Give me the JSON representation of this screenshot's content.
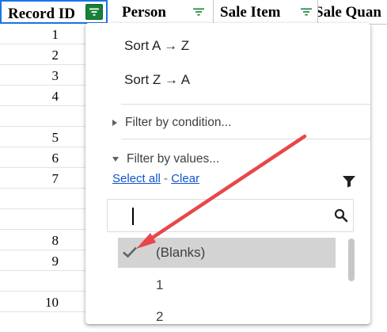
{
  "columns": [
    {
      "label": "Record ID",
      "filter_active": true
    },
    {
      "label": "Person",
      "filter_active": false
    },
    {
      "label": "Sale Item",
      "filter_active": false
    },
    {
      "label": "Sale Quan",
      "filter_active": false
    }
  ],
  "record_ids": [
    "1",
    "2",
    "3",
    "4",
    "",
    "5",
    "6",
    "7",
    "",
    "",
    "8",
    "9",
    "",
    "10"
  ],
  "menu": {
    "sort_az": "Sort A → Z",
    "sort_za": "Sort Z → A",
    "filter_by_condition": "Filter by condition...",
    "filter_by_values": "Filter by values...",
    "select_all": "Select all",
    "separator": " - ",
    "clear": "Clear",
    "search_value": "",
    "values": [
      {
        "label": "(Blanks)",
        "checked": true
      },
      {
        "label": "1",
        "checked": false
      },
      {
        "label": "2",
        "checked": false
      }
    ]
  },
  "colors": {
    "filter_active": "#188038",
    "selected_value_bg": "#d3d3d3",
    "link": "#1155cc",
    "annotation_arrow": "#e8474a"
  },
  "icons": {
    "filter": "filter-icon",
    "funnel": "funnel-icon",
    "search": "search-icon",
    "check": "check-icon"
  }
}
